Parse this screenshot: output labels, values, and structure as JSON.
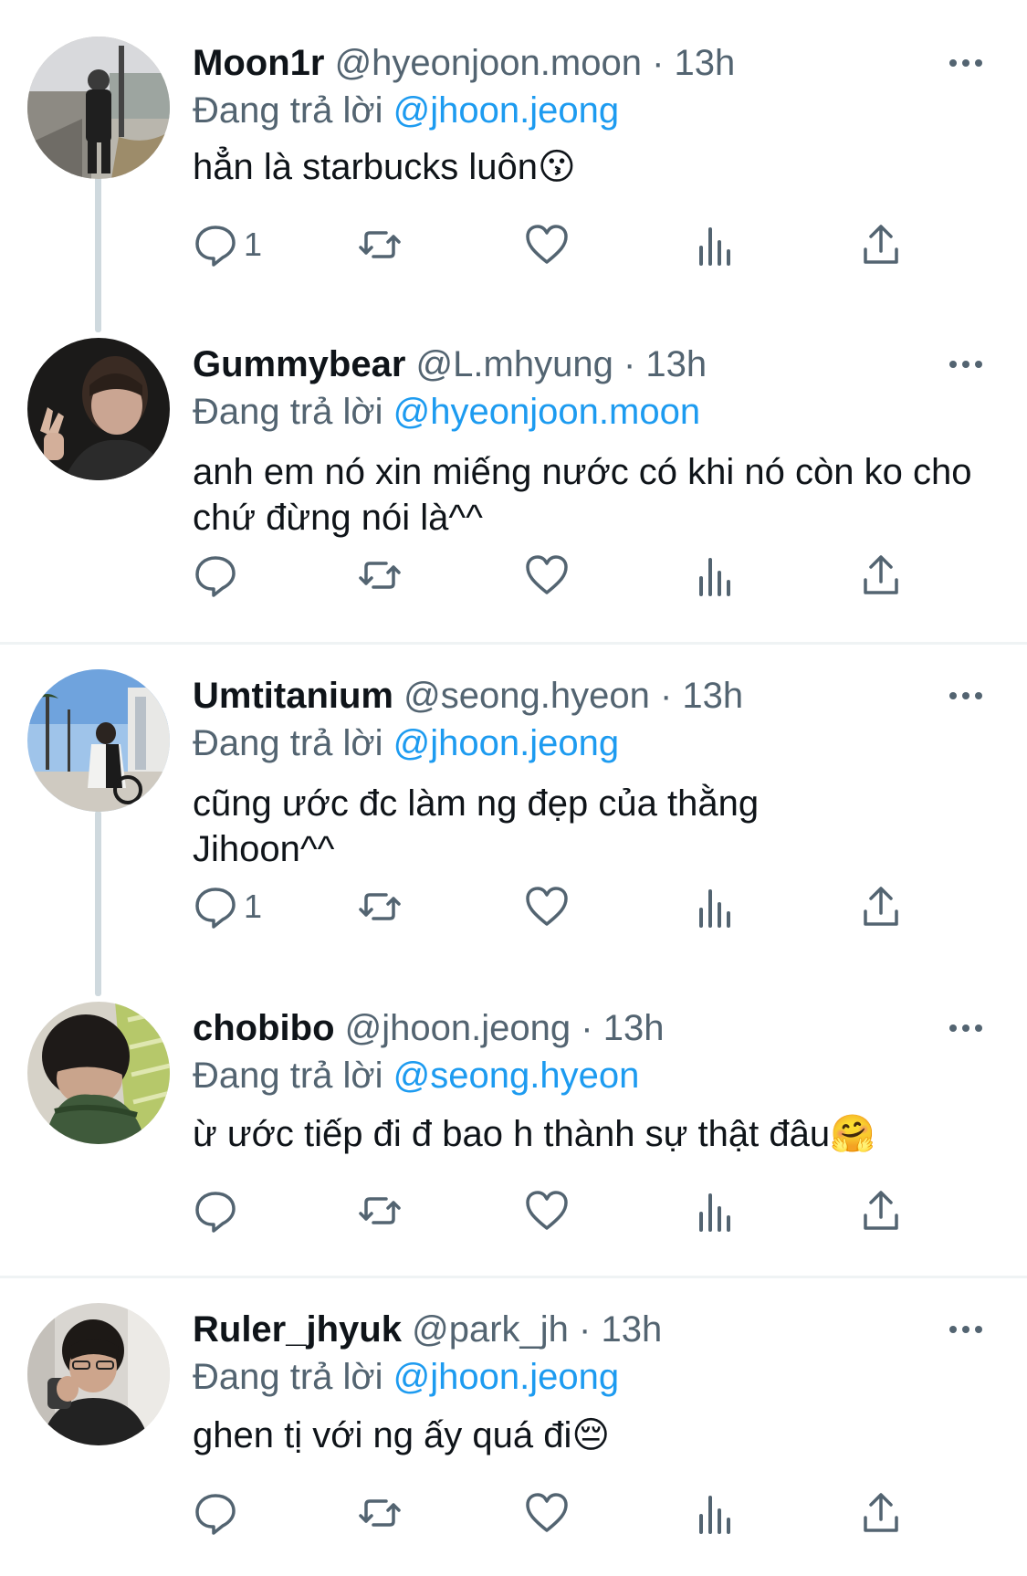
{
  "reply_prefix": "Đang trả lời",
  "separator": "·",
  "tweets": [
    {
      "display_name": "Moon1r",
      "handle": "@hyeonjoon.moon",
      "time": "13h",
      "reply_to": "@jhoon.jeong",
      "text": "hẳn là starbucks luôn😗",
      "reply_count": "1"
    },
    {
      "display_name": "Gummybear",
      "handle": "@L.mhyung",
      "time": "13h",
      "reply_to": "@hyeonjoon.moon",
      "text": "anh em nó xin miếng nước có khi nó còn ko cho chứ đừng nói là^^",
      "reply_count": ""
    },
    {
      "display_name": "Umtitanium",
      "handle": "@seong.hyeon",
      "time": "13h",
      "reply_to": "@jhoon.jeong",
      "text": "cũng ước đc làm ng đẹp của thằng Jihoon^^",
      "reply_count": "1"
    },
    {
      "display_name": "chobibo",
      "handle": "@jhoon.jeong",
      "time": "13h",
      "reply_to": "@seong.hyeon",
      "text": "ừ ước tiếp đi đ bao h thành sự thật đâu🤗",
      "reply_count": ""
    },
    {
      "display_name": "Ruler_jhyuk",
      "handle": "@park_jh",
      "time": "13h",
      "reply_to": "@jhoon.jeong",
      "text": "ghen tị với ng ấy quá đi😔",
      "reply_count": ""
    }
  ],
  "icons": {
    "reply": "reply-icon",
    "retweet": "retweet-icon",
    "like": "heart-icon",
    "views": "views-icon",
    "share": "share-icon",
    "more": "more-icon"
  },
  "colors": {
    "link": "#1d9bf0",
    "secondary_text": "#536471",
    "thread_line": "#cfd9de",
    "divider": "#eff3f4"
  }
}
